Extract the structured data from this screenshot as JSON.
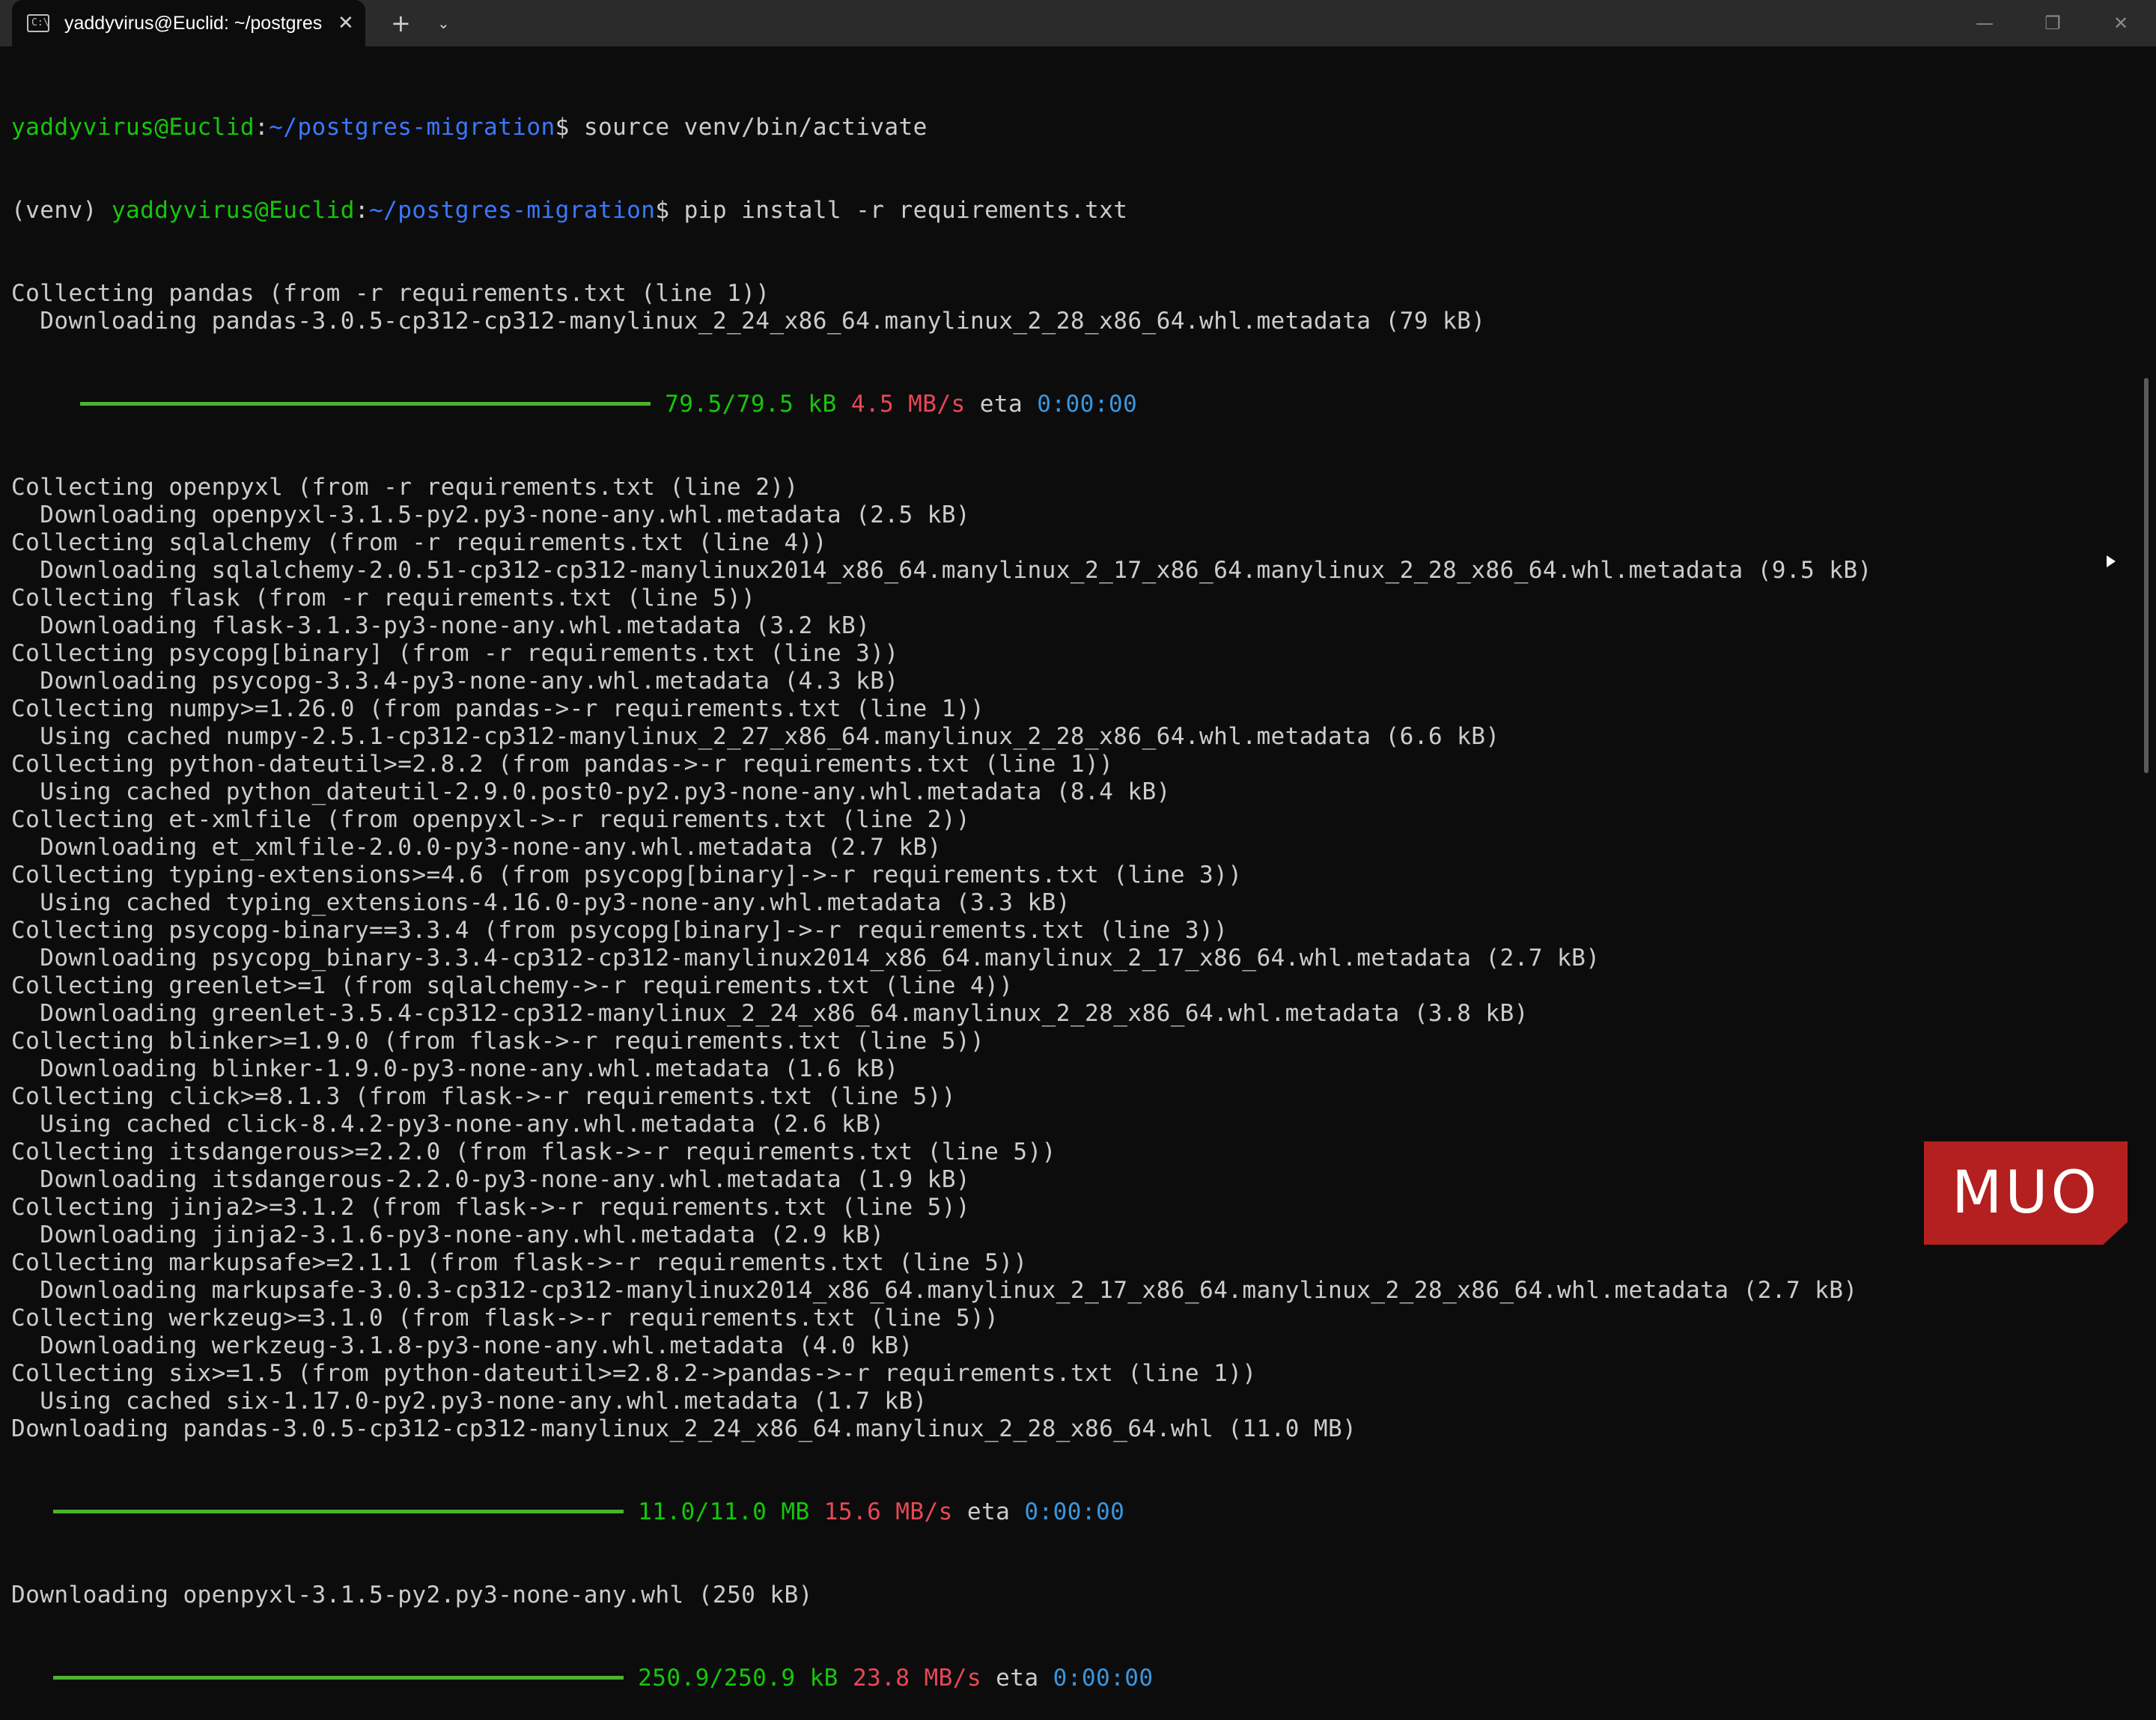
{
  "window": {
    "tab_title": "yaddyvirus@Euclid: ~/postgres-migration",
    "tab_icon_glyph": "C:\\",
    "close_glyph": "✕",
    "new_tab_glyph": "+",
    "dropdown_glyph": "⌄",
    "minimize_glyph": "—",
    "maximize_glyph": "❐",
    "window_close_glyph": "✕"
  },
  "terminal": {
    "prompt1": {
      "user": "yaddyvirus@Euclid",
      "colon": ":",
      "path": "~/postgres-migration",
      "dollar": "$",
      "command": " source venv/bin/activate"
    },
    "prompt2": {
      "venv": "(venv) ",
      "user": "yaddyvirus@Euclid",
      "colon": ":",
      "path": "~/postgres-migration",
      "dollar": "$",
      "command": " pip install -r requirements.txt"
    },
    "lines_a": [
      "Collecting pandas (from -r requirements.txt (line 1))",
      "  Downloading pandas-3.0.5-cp312-cp312-manylinux_2_24_x86_64.manylinux_2_28_x86_64.whl.metadata (79 kB)"
    ],
    "progress1": {
      "size": "79.5/79.5 kB",
      "speed": "4.5 MB/s",
      "eta_label": "eta",
      "eta": "0:00:00",
      "fraction": 1.0
    },
    "lines_b": [
      "Collecting openpyxl (from -r requirements.txt (line 2))",
      "  Downloading openpyxl-3.1.5-py2.py3-none-any.whl.metadata (2.5 kB)",
      "Collecting sqlalchemy (from -r requirements.txt (line 4))",
      "  Downloading sqlalchemy-2.0.51-cp312-cp312-manylinux2014_x86_64.manylinux_2_17_x86_64.manylinux_2_28_x86_64.whl.metadata (9.5 kB)",
      "Collecting flask (from -r requirements.txt (line 5))",
      "  Downloading flask-3.1.3-py3-none-any.whl.metadata (3.2 kB)",
      "Collecting psycopg[binary] (from -r requirements.txt (line 3))",
      "  Downloading psycopg-3.3.4-py3-none-any.whl.metadata (4.3 kB)",
      "Collecting numpy>=1.26.0 (from pandas->-r requirements.txt (line 1))",
      "  Using cached numpy-2.5.1-cp312-cp312-manylinux_2_27_x86_64.manylinux_2_28_x86_64.whl.metadata (6.6 kB)",
      "Collecting python-dateutil>=2.8.2 (from pandas->-r requirements.txt (line 1))",
      "  Using cached python_dateutil-2.9.0.post0-py2.py3-none-any.whl.metadata (8.4 kB)",
      "Collecting et-xmlfile (from openpyxl->-r requirements.txt (line 2))",
      "  Downloading et_xmlfile-2.0.0-py3-none-any.whl.metadata (2.7 kB)",
      "Collecting typing-extensions>=4.6 (from psycopg[binary]->-r requirements.txt (line 3))",
      "  Using cached typing_extensions-4.16.0-py3-none-any.whl.metadata (3.3 kB)",
      "Collecting psycopg-binary==3.3.4 (from psycopg[binary]->-r requirements.txt (line 3))",
      "  Downloading psycopg_binary-3.3.4-cp312-cp312-manylinux2014_x86_64.manylinux_2_17_x86_64.whl.metadata (2.7 kB)",
      "Collecting greenlet>=1 (from sqlalchemy->-r requirements.txt (line 4))",
      "  Downloading greenlet-3.5.4-cp312-cp312-manylinux_2_24_x86_64.manylinux_2_28_x86_64.whl.metadata (3.8 kB)",
      "Collecting blinker>=1.9.0 (from flask->-r requirements.txt (line 5))",
      "  Downloading blinker-1.9.0-py3-none-any.whl.metadata (1.6 kB)",
      "Collecting click>=8.1.3 (from flask->-r requirements.txt (line 5))",
      "  Using cached click-8.4.2-py3-none-any.whl.metadata (2.6 kB)",
      "Collecting itsdangerous>=2.2.0 (from flask->-r requirements.txt (line 5))",
      "  Downloading itsdangerous-2.2.0-py3-none-any.whl.metadata (1.9 kB)",
      "Collecting jinja2>=3.1.2 (from flask->-r requirements.txt (line 5))",
      "  Downloading jinja2-3.1.6-py3-none-any.whl.metadata (2.9 kB)",
      "Collecting markupsafe>=2.1.1 (from flask->-r requirements.txt (line 5))",
      "  Downloading markupsafe-3.0.3-cp312-cp312-manylinux2014_x86_64.manylinux_2_17_x86_64.manylinux_2_28_x86_64.whl.metadata (2.7 kB)",
      "Collecting werkzeug>=3.1.0 (from flask->-r requirements.txt (line 5))",
      "  Downloading werkzeug-3.1.8-py3-none-any.whl.metadata (4.0 kB)",
      "Collecting six>=1.5 (from python-dateutil>=2.8.2->pandas->-r requirements.txt (line 1))",
      "  Using cached six-1.17.0-py2.py3-none-any.whl.metadata (1.7 kB)",
      "Downloading pandas-3.0.5-cp312-cp312-manylinux_2_24_x86_64.manylinux_2_28_x86_64.whl (11.0 MB)"
    ],
    "progress2": {
      "size": "11.0/11.0 MB",
      "speed": "15.6 MB/s",
      "eta_label": "eta",
      "eta": "0:00:00",
      "fraction": 1.0
    },
    "line_c": "Downloading openpyxl-3.1.5-py2.py3-none-any.whl (250 kB)",
    "progress3": {
      "size": "250.9/250.9 kB",
      "speed": "23.8 MB/s",
      "eta_label": "eta",
      "eta": "0:00:00",
      "fraction": 1.0
    }
  },
  "watermark": {
    "text": "MUO"
  },
  "colors": {
    "user": "#16c60c",
    "path": "#3b78ff",
    "speed": "#e74856",
    "eta": "#3a96dd",
    "bar": "#4bb32e",
    "logo": "#b3201f"
  }
}
